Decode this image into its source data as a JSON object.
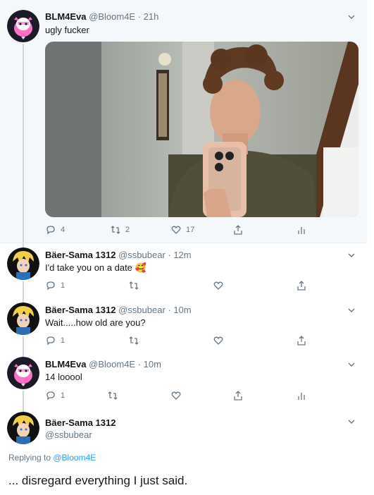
{
  "tweets": [
    {
      "name": "BLM4Eva",
      "meta": "@Bloom4E · 21h",
      "text": "ugly fucker",
      "replies": "4",
      "retweets": "2",
      "likes": "17"
    },
    {
      "name": "Bäer-Sama 1312",
      "meta": "@ssbubear · 12m",
      "text": "I'd take you on a date 🥰",
      "replies": "1"
    },
    {
      "name": "Bäer-Sama 1312",
      "meta": "@ssbubear · 10m",
      "text": "Wait.....how old are you?",
      "replies": "1"
    },
    {
      "name": "BLM4Eva",
      "meta": "@Bloom4E · 10m",
      "text": "14 looool",
      "replies": "1"
    }
  ],
  "focused": {
    "name": "Bäer-Sama 1312",
    "handle": "@ssbubear",
    "replying_prefix": "Replying to ",
    "replying_to": "@Bloom4E",
    "text": "... disregard everything I just said."
  },
  "colors": {
    "accent": "#1da1f2",
    "muted": "#657786",
    "text": "#14171a"
  }
}
